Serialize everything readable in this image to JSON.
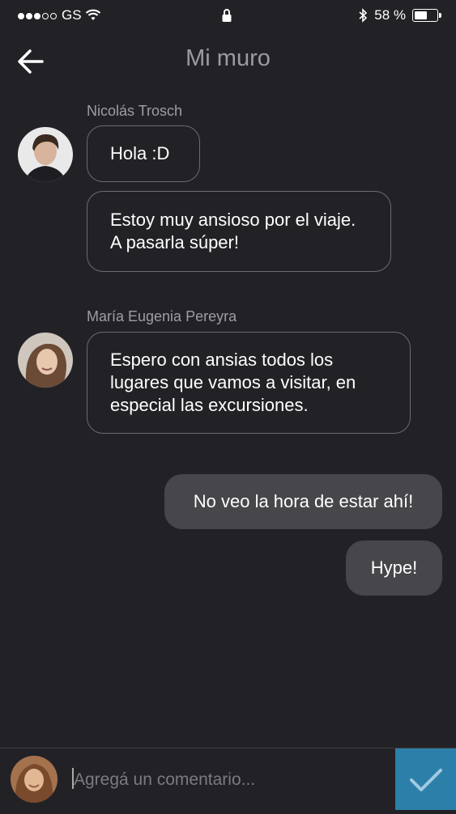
{
  "status_bar": {
    "carrier": "GS",
    "battery": "58 %",
    "battery_level": 0.58,
    "signal_filled": 3,
    "signal_total": 5
  },
  "nav": {
    "title": "Mi muro"
  },
  "messages": [
    {
      "sender": "Nicolás Trosch",
      "bubbles": [
        "Hola :D",
        "Estoy muy ansioso por el viaje.\nA pasarla súper!"
      ]
    },
    {
      "sender": "María Eugenia Pereyra",
      "bubbles": [
        "Espero con ansias todos los\nlugares que vamos a visitar, en\nespecial las excursiones."
      ]
    }
  ],
  "own_messages": [
    "No veo la hora de estar ahí!",
    "Hype!"
  ],
  "composer": {
    "placeholder": "Agregá un comentario..."
  },
  "colors": {
    "background": "#222226",
    "send_button": "#2c7fa8",
    "outgoing_bubble": "#46464b",
    "incoming_border": "#6b6b70"
  },
  "icons": [
    "signal-dots-icon",
    "wifi-icon",
    "lock-icon",
    "bluetooth-icon",
    "battery-icon",
    "back-arrow-icon",
    "checkmark-icon"
  ]
}
